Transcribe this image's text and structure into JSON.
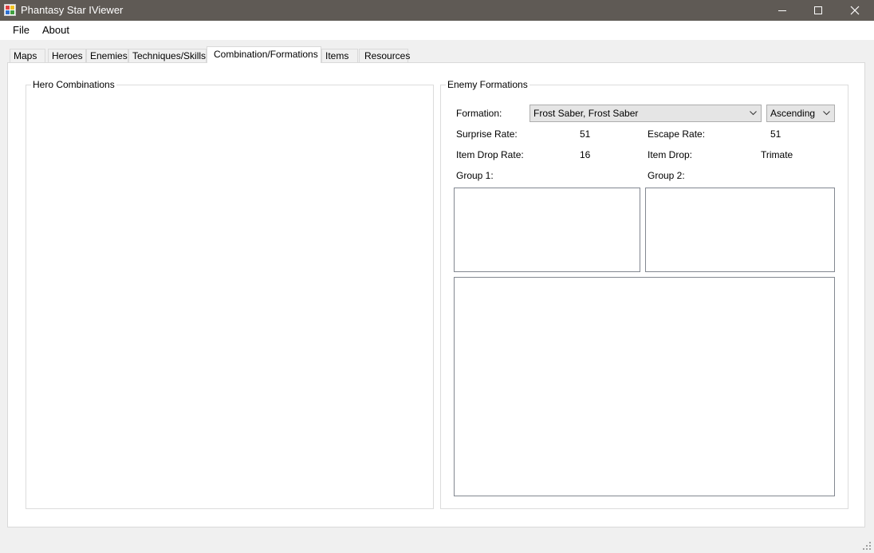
{
  "window": {
    "title": "Phantasy Star IViewer",
    "icon": "app-icon"
  },
  "menu": {
    "file": "File",
    "about": "About"
  },
  "tabs": [
    {
      "label": "Maps"
    },
    {
      "label": "Heroes"
    },
    {
      "label": "Enemies"
    },
    {
      "label": "Techniques/Skills"
    },
    {
      "label": "Combination/Formations",
      "active": true
    },
    {
      "label": "Items"
    },
    {
      "label": "Resources"
    }
  ],
  "hero_combinations": {
    "title": "Hero Combinations"
  },
  "enemy_formations": {
    "title": "Enemy Formations",
    "formation_label": "Formation:",
    "formation_value": "Frost Saber, Frost Saber",
    "sort_value": "Ascending",
    "surprise_rate_label": "Surprise Rate:",
    "surprise_rate_value": "51",
    "escape_rate_label": "Escape Rate:",
    "escape_rate_value": "51",
    "item_drop_rate_label": "Item Drop Rate:",
    "item_drop_rate_value": "16",
    "item_drop_label": "Item Drop:",
    "item_drop_value": "Trimate",
    "group1_label": "Group 1:",
    "group2_label": "Group 2:"
  }
}
